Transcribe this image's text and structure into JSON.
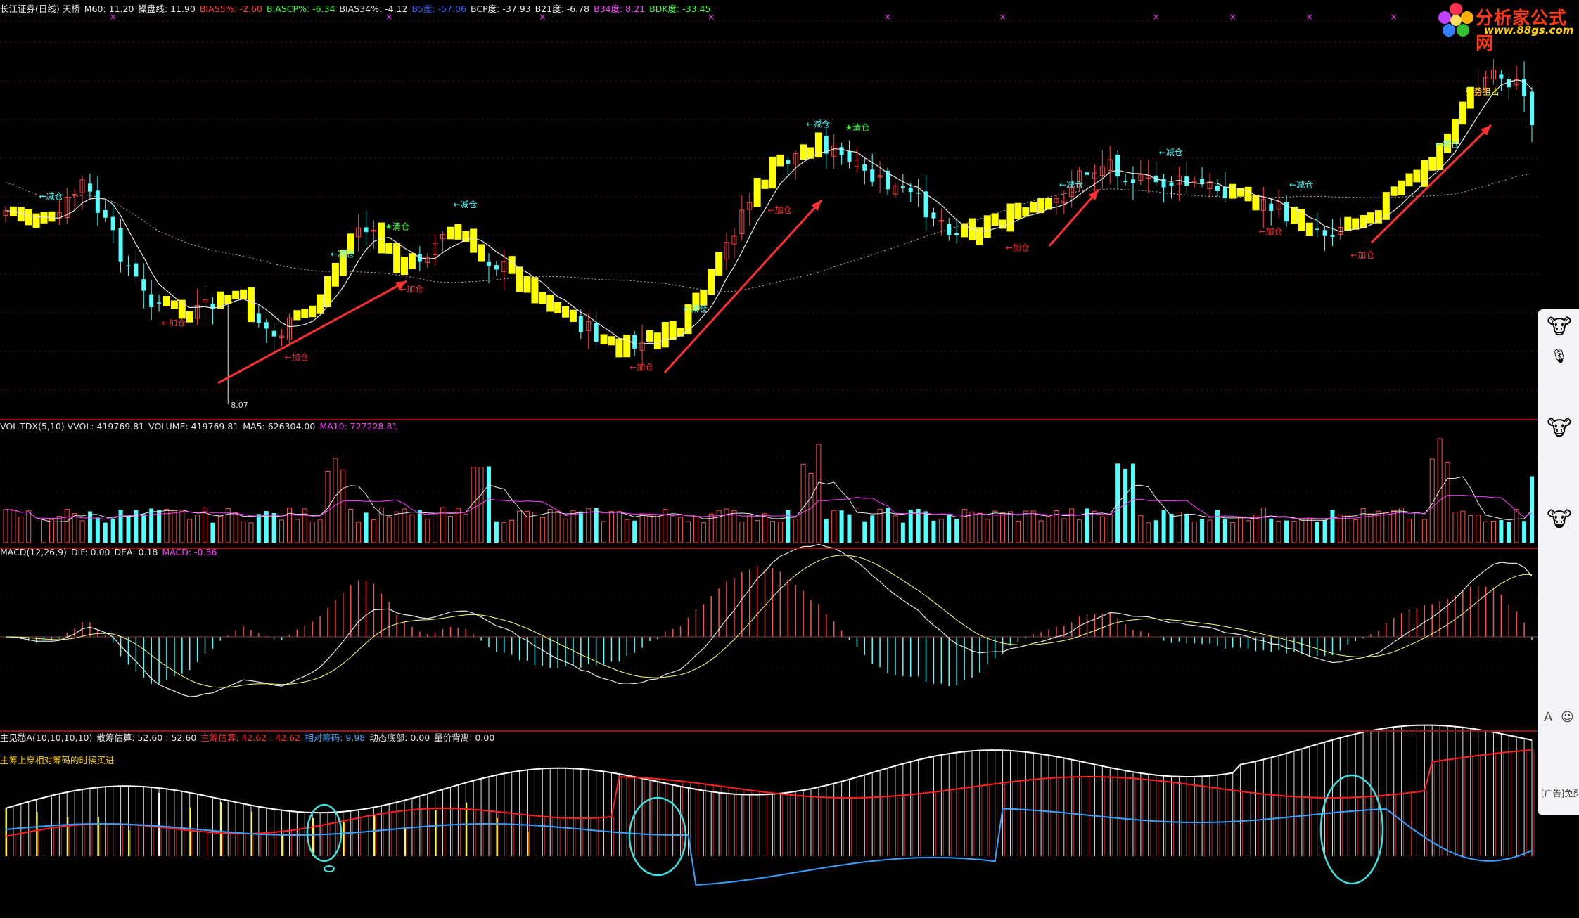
{
  "header_main": [
    {
      "text": "长江证券(日线) 天桥",
      "color": "#e8e8e8"
    },
    {
      "text": "M60: 11.20",
      "color": "#e8e8e8"
    },
    {
      "text": "操盘线: 11.90",
      "color": "#e8e8e8"
    },
    {
      "text": "BIAS5%: -2.60",
      "color": "#ff4040"
    },
    {
      "text": "BIASCP%: -6.34",
      "color": "#40ff40"
    },
    {
      "text": "BIAS34%: -4.12",
      "color": "#e8e8e8"
    },
    {
      "text": "B5度: -57.06",
      "color": "#3060ff"
    },
    {
      "text": "BCP度: -37.93",
      "color": "#e8e8e8"
    },
    {
      "text": "B21度: -6.78",
      "color": "#e8e8e8"
    },
    {
      "text": "B34度: 8.21",
      "color": "#ff40ff"
    },
    {
      "text": "BDK度: -33.45",
      "color": "#40ff40"
    }
  ],
  "header_vol": [
    {
      "text": "VOL-TDX(5,10) VVOL: 419769.81",
      "color": "#e8e8e8"
    },
    {
      "text": "VOLUME: 419769.81",
      "color": "#e8e8e8"
    },
    {
      "text": "MA5: 626304.00",
      "color": "#e8e8e8"
    },
    {
      "text": "MA10: 727228.81",
      "color": "#ff40ff"
    }
  ],
  "header_macd": [
    {
      "text": "MACD(12,26,9)",
      "color": "#e8e8e8"
    },
    {
      "text": "DIF: 0.00",
      "color": "#e8e8e8"
    },
    {
      "text": "DEA: 0.18",
      "color": "#e8e8e8"
    },
    {
      "text": "MACD: -0.36",
      "color": "#ff40ff"
    }
  ],
  "header_chip": [
    {
      "text": "主见愁A(10,10,10,10)",
      "color": "#e8e8e8"
    },
    {
      "text": "散筹估算: 52.60 : 52.60",
      "color": "#e8e8e8"
    },
    {
      "text": "主筹估算: 42.62 : 42.62",
      "color": "#ff3030"
    },
    {
      "text": "相对筹码: 9.98",
      "color": "#4aa8ff"
    },
    {
      "text": "动态底部: 0.00",
      "color": "#e8e8e8"
    },
    {
      "text": "量价背离: 0.00",
      "color": "#e8e8e8"
    }
  ],
  "chip_hint": "主筹上穿相对筹码的时候买进",
  "logo": {
    "title": "分析家公式网",
    "url": "www.88gs.com"
  },
  "sidebar": {
    "ad_text": "[广告]免费"
  },
  "chart_data": [
    {
      "type": "candlestick",
      "panel": "price",
      "low_label": "8.07",
      "ma_series": [
        "M60",
        "操盘线"
      ],
      "annotations": [
        {
          "bar": 4,
          "text": "减仓",
          "kind": "reduce"
        },
        {
          "bar": 20,
          "text": "加仓",
          "kind": "add"
        },
        {
          "bar": 36,
          "text": "加仓",
          "kind": "add"
        },
        {
          "bar": 42,
          "text": "减仓",
          "kind": "reduce"
        },
        {
          "bar": 50,
          "text": "清仓",
          "kind": "clear"
        },
        {
          "bar": 51,
          "text": "加仓",
          "kind": "add"
        },
        {
          "bar": 58,
          "text": "减仓",
          "kind": "reduce"
        },
        {
          "bar": 81,
          "text": "加仓",
          "kind": "add"
        },
        {
          "bar": 88,
          "text": "减仓",
          "kind": "reduce"
        },
        {
          "bar": 99,
          "text": "加仓",
          "kind": "add"
        },
        {
          "bar": 104,
          "text": "减仓",
          "kind": "reduce"
        },
        {
          "bar": 110,
          "text": "清仓",
          "kind": "clear"
        },
        {
          "bar": 130,
          "text": "加仓",
          "kind": "add"
        },
        {
          "bar": 137,
          "text": "减仓",
          "kind": "reduce"
        },
        {
          "bar": 150,
          "text": "减仓",
          "kind": "reduce"
        },
        {
          "bar": 163,
          "text": "加仓",
          "kind": "add"
        },
        {
          "bar": 167,
          "text": "减仓",
          "kind": "reduce"
        },
        {
          "bar": 175,
          "text": "加仓",
          "kind": "add"
        },
        {
          "bar": 186,
          "text": "减仓",
          "kind": "reduce"
        },
        {
          "bar": 190,
          "text": "强势狙击",
          "kind": "strong"
        }
      ]
    },
    {
      "type": "bar",
      "panel": "volume",
      "series": [
        "VOLUME",
        "MA5",
        "MA10"
      ]
    },
    {
      "type": "bar",
      "panel": "macd",
      "series": [
        "DIF",
        "DEA",
        "MACD"
      ]
    },
    {
      "type": "area",
      "panel": "chip",
      "series": [
        "散筹估算",
        "主筹估算",
        "相对筹码"
      ]
    }
  ]
}
